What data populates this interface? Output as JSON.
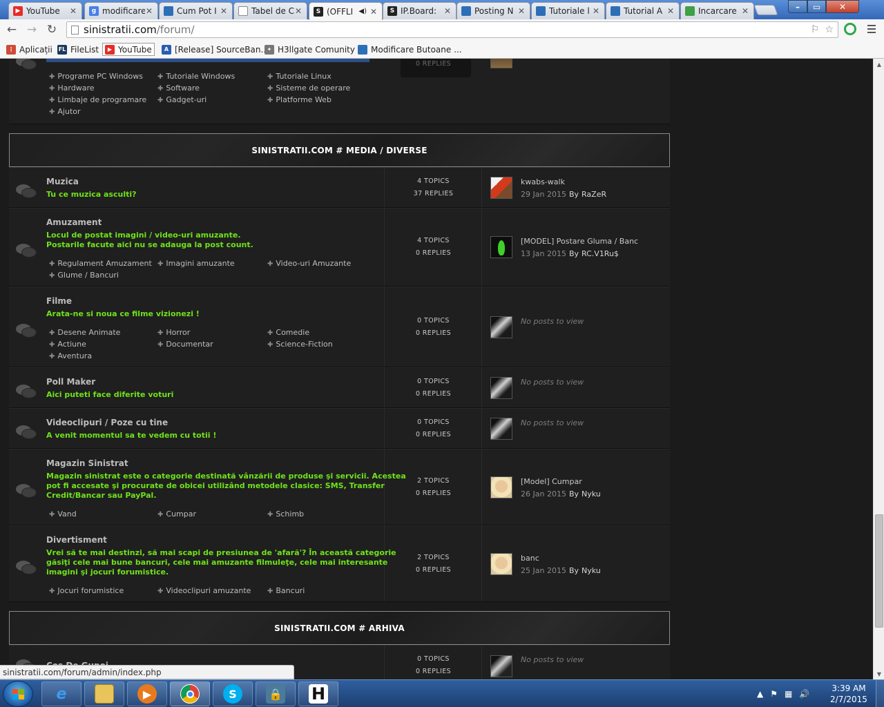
{
  "browser": {
    "tabs": [
      {
        "label": "YouTube",
        "icon_color": "#e52d27",
        "icon_text": "▶"
      },
      {
        "label": "modificare",
        "icon_color": "#4a7ee8",
        "icon_text": "g"
      },
      {
        "label": "Cum Pot I",
        "icon_color": "#2d6fb6",
        "icon_text": ""
      },
      {
        "label": "Tabel de C",
        "icon_color": "#ffffff",
        "icon_text": ""
      },
      {
        "label": "(OFFLI",
        "icon_color": "#222222",
        "icon_text": "S"
      },
      {
        "label": "IP.Board:",
        "icon_color": "#222222",
        "icon_text": "S"
      },
      {
        "label": "Posting N",
        "icon_color": "#2d6fb6",
        "icon_text": ""
      },
      {
        "label": "Tutoriale l",
        "icon_color": "#2d6fb6",
        "icon_text": ""
      },
      {
        "label": "Tutorial A",
        "icon_color": "#2d6fb6",
        "icon_text": ""
      },
      {
        "label": "Incarcare",
        "icon_color": "#3fa046",
        "icon_text": ""
      }
    ],
    "url_host": "sinistratii.com",
    "url_path": "/forum/",
    "bookmarks": [
      {
        "label": "Aplicații",
        "icon_color": "#d04a3a",
        "icon_text": "⋮"
      },
      {
        "label": "FileList",
        "icon_color": "#1a3a5c",
        "icon_text": "FL"
      },
      {
        "label": "YouTube",
        "icon_color": "#e52d27",
        "icon_text": "▶"
      },
      {
        "label": "[Release] SourceBan...",
        "icon_color": "#2a5db0",
        "icon_text": "A"
      },
      {
        "label": "H3llgate Comunity",
        "icon_color": "#777777",
        "icon_text": "✦"
      },
      {
        "label": "Modificare Butoane ...",
        "icon_color": "#2d6fb6",
        "icon_text": ""
      }
    ],
    "status_url": "sinistratii.com/forum/admin/index.php"
  },
  "top_partial": {
    "subforums": [
      "Programe PC Windows",
      "Tutoriale Windows",
      "Tutoriale Linux",
      "Hardware",
      "Software",
      "Sisteme de operare",
      "Limbaje de programare",
      "Gadget-uri",
      "Platforme Web",
      "Ajutor"
    ],
    "replies": "0 REPLIES"
  },
  "categories": {
    "media": "SINISTRATII.COM # MEDIA / DIVERSE",
    "arhiva": "SINISTRATII.COM # ARHIVA"
  },
  "forums": [
    {
      "title": "Muzica",
      "desc": [
        "Tu ce muzica asculti?"
      ],
      "subforums": [],
      "topics": "4 TOPICS",
      "replies": "37 REPLIES",
      "last_title": "kwabs-walk",
      "last_date": "29 Jan 2015",
      "last_by": "RaZeR",
      "avatar": "car"
    },
    {
      "title": "Amuzament",
      "desc": [
        "Locul de postat imagini / video-uri amuzante.",
        "Postarile facute aici nu se adauga la post count."
      ],
      "subforums": [
        "Regulament Amuzament",
        "Imagini amuzante",
        "Video-uri Amuzante",
        "Glume / Bancuri"
      ],
      "topics": "4 TOPICS",
      "replies": "0 REPLIES",
      "last_title": "[MODEL] Postare Gluma / Banc",
      "last_date": "13 Jan 2015",
      "last_by": "RC.V1Ru$",
      "avatar": "leaf"
    },
    {
      "title": "Filme",
      "desc": [
        "Arata-ne si noua ce filme vizionezi !"
      ],
      "subforums": [
        "Desene Animate",
        "Horror",
        "Comedie",
        "Actiune",
        "Documentar",
        "Science-Fiction",
        "Aventura"
      ],
      "topics": "0 TOPICS",
      "replies": "0 REPLIES",
      "no_posts": "No posts to view",
      "avatar": "dark"
    },
    {
      "title": "Poll Maker",
      "desc": [
        "Aici puteti face diferite voturi"
      ],
      "subforums": [],
      "topics": "0 TOPICS",
      "replies": "0 REPLIES",
      "no_posts": "No posts to view",
      "avatar": "dark"
    },
    {
      "title": "Videoclipuri / Poze cu tine",
      "desc": [
        "A venit momentul sa te vedem cu totii !"
      ],
      "subforums": [],
      "topics": "0 TOPICS",
      "replies": "0 REPLIES",
      "no_posts": "No posts to view",
      "avatar": "dark"
    },
    {
      "title": "Magazin Sinistrat",
      "desc": [
        "Magazin sinistrat este o categorie destinată vânzării de produse şi servicii. Acestea",
        "pot fi accesate şi procurate de obicei utilizând metodele clasice: SMS, Transfer",
        "Credit/Bancar sau PayPal."
      ],
      "subforums": [
        "Vand",
        "Cumpar",
        "Schimb"
      ],
      "topics": "2 TOPICS",
      "replies": "0 REPLIES",
      "last_title": "[Model] Cumpar",
      "last_date": "26 Jan 2015",
      "last_by": "Nyku",
      "avatar": "face"
    },
    {
      "title": "Divertisment",
      "desc": [
        "Vrei să te mai destinzi, să mai scapi de presiunea de 'afară'? În această categorie",
        "găsiţi cele mai bune bancuri, cele mai amuzante filmuleţe, cele mai interesante",
        "imagini şi jocuri forumistice."
      ],
      "subforums": [
        "Jocuri forumistice",
        "Videoclipuri amuzante",
        "Bancuri"
      ],
      "topics": "2 TOPICS",
      "replies": "0 REPLIES",
      "last_title": "banc",
      "last_date": "25 Jan 2015",
      "last_by": "Nyku",
      "avatar": "face"
    }
  ],
  "arhiva_row": {
    "title": "Cos De Gunoi",
    "topics": "0 TOPICS",
    "replies": "0 REPLIES",
    "no_posts": "No posts to view"
  },
  "by_label": "By",
  "taskbar": {
    "time": "3:39 AM",
    "date": "2/7/2015"
  }
}
